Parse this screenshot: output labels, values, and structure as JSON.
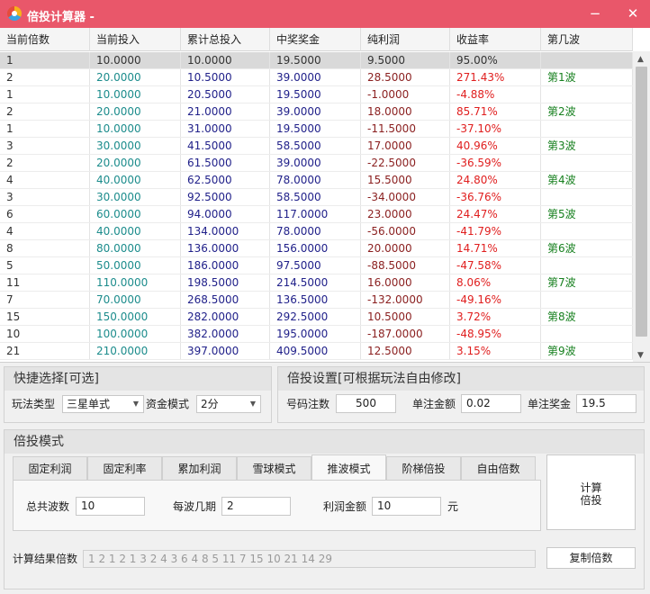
{
  "window": {
    "title": "倍投计算器 -",
    "minimize_glyph": "−",
    "close_glyph": "✕"
  },
  "grid": {
    "columns": [
      "当前倍数",
      "当前投入",
      "累计总投入",
      "中奖奖金",
      "纯利润",
      "收益率",
      "第几波"
    ],
    "rows": [
      [
        "1",
        "10.0000",
        "10.0000",
        "19.5000",
        "9.5000",
        "95.00%",
        ""
      ],
      [
        "2",
        "20.0000",
        "10.5000",
        "39.0000",
        "28.5000",
        "271.43%",
        "第1波"
      ],
      [
        "1",
        "10.0000",
        "20.5000",
        "19.5000",
        "-1.0000",
        "-4.88%",
        ""
      ],
      [
        "2",
        "20.0000",
        "21.0000",
        "39.0000",
        "18.0000",
        "85.71%",
        "第2波"
      ],
      [
        "1",
        "10.0000",
        "31.0000",
        "19.5000",
        "-11.5000",
        "-37.10%",
        ""
      ],
      [
        "3",
        "30.0000",
        "41.5000",
        "58.5000",
        "17.0000",
        "40.96%",
        "第3波"
      ],
      [
        "2",
        "20.0000",
        "61.5000",
        "39.0000",
        "-22.5000",
        "-36.59%",
        ""
      ],
      [
        "4",
        "40.0000",
        "62.5000",
        "78.0000",
        "15.5000",
        "24.80%",
        "第4波"
      ],
      [
        "3",
        "30.0000",
        "92.5000",
        "58.5000",
        "-34.0000",
        "-36.76%",
        ""
      ],
      [
        "6",
        "60.0000",
        "94.0000",
        "117.0000",
        "23.0000",
        "24.47%",
        "第5波"
      ],
      [
        "4",
        "40.0000",
        "134.0000",
        "78.0000",
        "-56.0000",
        "-41.79%",
        ""
      ],
      [
        "8",
        "80.0000",
        "136.0000",
        "156.0000",
        "20.0000",
        "14.71%",
        "第6波"
      ],
      [
        "5",
        "50.0000",
        "186.0000",
        "97.5000",
        "-88.5000",
        "-47.58%",
        ""
      ],
      [
        "11",
        "110.0000",
        "198.5000",
        "214.5000",
        "16.0000",
        "8.06%",
        "第7波"
      ],
      [
        "7",
        "70.0000",
        "268.5000",
        "136.5000",
        "-132.0000",
        "-49.16%",
        ""
      ],
      [
        "15",
        "150.0000",
        "282.0000",
        "292.5000",
        "10.5000",
        "3.72%",
        "第8波"
      ],
      [
        "10",
        "100.0000",
        "382.0000",
        "195.0000",
        "-187.0000",
        "-48.95%",
        ""
      ],
      [
        "21",
        "210.0000",
        "397.0000",
        "409.5000",
        "12.5000",
        "3.15%",
        "第9波"
      ]
    ],
    "selected_row": 0,
    "column_colors": [
      "#333333",
      "#1c8c8c",
      "#21218a",
      "#21218a",
      "#8a1f1f",
      "#e01e1e",
      "#17801f"
    ]
  },
  "quick_select": {
    "title": "快捷选择[可选]",
    "play_type_label": "玩法类型",
    "play_type_value": "三星单式",
    "fund_mode_label": "资金模式",
    "fund_mode_value": "2分"
  },
  "settings": {
    "title": "倍投设置[可根据玩法自由修改]",
    "bet_count_label": "号码注数",
    "bet_count_value": "500",
    "unit_amount_label": "单注金额",
    "unit_amount_value": "0.02",
    "unit_prize_label": "单注奖金",
    "unit_prize_value": "19.5"
  },
  "mode": {
    "title": "倍投模式",
    "tabs": [
      "固定利润",
      "固定利率",
      "累加利润",
      "雪球模式",
      "推波模式",
      "阶梯倍投",
      "自由倍数"
    ],
    "active_tab": 4,
    "total_waves_label": "总共波数",
    "total_waves_value": "10",
    "periods_per_wave_label": "每波几期",
    "periods_per_wave_value": "2",
    "profit_amount_label": "利润金额",
    "profit_amount_value": "10",
    "profit_unit": "元",
    "calc_button_line1": "计算",
    "calc_button_line2": "倍投",
    "result_label": "计算结果倍数",
    "result_value": "1 2 1 2 1 3 2 4 3 6 4 8 5 11 7 15 10 21 14 29",
    "copy_button": "复制倍数"
  }
}
